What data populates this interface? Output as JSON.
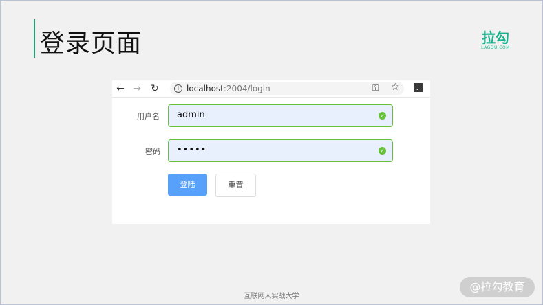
{
  "slide": {
    "title": "登录页面",
    "logo_main": "拉勾",
    "logo_sub": "LAGOU.COM",
    "footer": "互联网人实战大学",
    "watermark": "@拉勾教育"
  },
  "browser": {
    "url_host": "localhost",
    "url_path": ":2004/login",
    "icons": [
      "back-arrow-icon",
      "forward-arrow-icon",
      "reload-icon",
      "info-icon",
      "key-icon",
      "star-icon",
      "extension-icon"
    ]
  },
  "form": {
    "username_label": "用户名",
    "username_value": "admin",
    "password_label": "密码",
    "password_value": "•••••",
    "login_button": "登陆",
    "reset_button": "重置"
  },
  "colors": {
    "accent": "#16b28c",
    "valid_border": "#67c23a",
    "primary_button": "#58a1fb"
  }
}
